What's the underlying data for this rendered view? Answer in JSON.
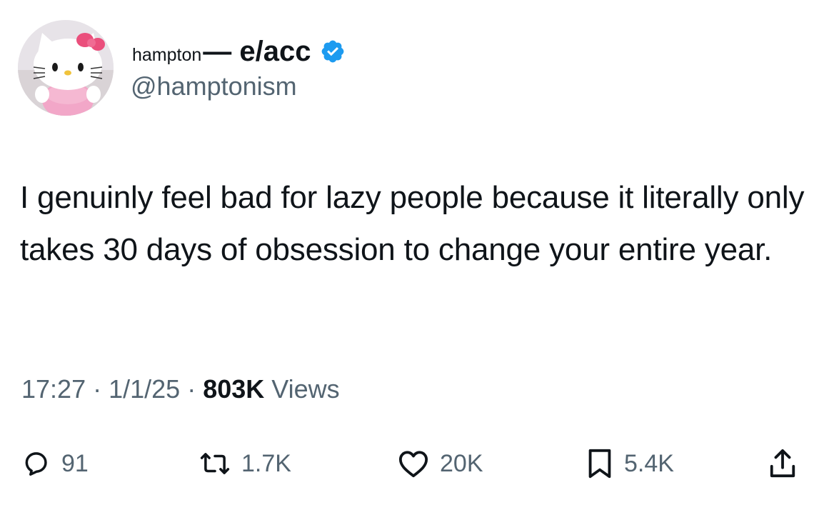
{
  "author": {
    "display_name_prefix": "hampton",
    "display_name_suffix": "— e/acc",
    "handle": "@hamptonism",
    "verified_color": "#1d9bf0",
    "avatar_icon": "hello-kitty-avatar"
  },
  "tweet": {
    "text": "I genuinly feel bad for lazy people because it literally only takes 30 days of obsession to change your entire year.",
    "time": "17:27",
    "date": "1/1/25",
    "views_count": "803K",
    "views_label": "Views"
  },
  "actions": {
    "replies": "91",
    "reposts": "1.7K",
    "likes": "20K",
    "bookmarks": "5.4K"
  },
  "colors": {
    "text_primary": "#0f1419",
    "text_secondary": "#536471",
    "accent": "#1d9bf0"
  }
}
